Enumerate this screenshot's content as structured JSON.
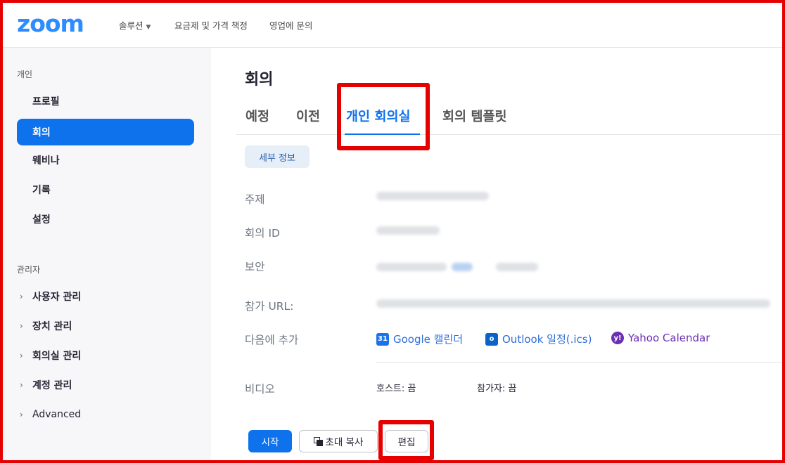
{
  "header": {
    "logo": "zoom",
    "nav": [
      "솔루션",
      "요금제 및 가격 책정",
      "영업에 문의"
    ]
  },
  "sidebar": {
    "personal_label": "개인",
    "personal_items": [
      "프로필",
      "회의",
      "웨비나",
      "기록",
      "설정"
    ],
    "admin_label": "관리자",
    "admin_items": [
      "사용자 관리",
      "장치 관리",
      "회의실 관리",
      "계정 관리",
      "Advanced"
    ],
    "active_item": "회의"
  },
  "main": {
    "title": "회의",
    "tabs": [
      "예정",
      "이전",
      "개인 회의실",
      "회의 템플릿"
    ],
    "active_tab": "개인 회의실",
    "details_button": "세부 정보",
    "rows": {
      "topic_label": "주제",
      "meeting_id_label": "회의 ID",
      "security_label": "보안",
      "join_url_label": "참가 URL:",
      "add_to_label": "다음에 추가",
      "video_label": "비디오"
    },
    "calendar_links": {
      "google": "Google 캘린더",
      "outlook": "Outlook 일정(.ics)",
      "yahoo": "Yahoo Calendar"
    },
    "video": {
      "host": "호스트: 끔",
      "participant": "참가자: 끔"
    },
    "actions": {
      "start": "시작",
      "copy_invite": "초대 복사",
      "edit": "편집"
    }
  },
  "colors": {
    "brand": "#2d8cff",
    "primary": "#0e72ed",
    "highlight": "#e60000"
  }
}
